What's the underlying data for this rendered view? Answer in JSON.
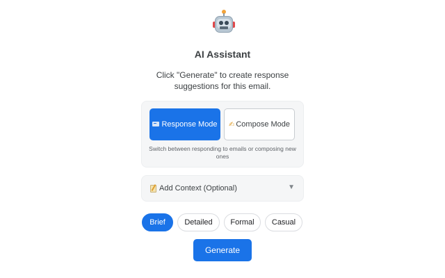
{
  "header": {
    "icon": "robot-icon",
    "title": "AI Assistant",
    "description": "Click \"Generate\" to create response suggestions for this email."
  },
  "modes": {
    "response": {
      "icon": "id-card-icon",
      "label": "Response Mode",
      "active": true
    },
    "compose": {
      "icon": "pencil-icon",
      "label": "Compose Mode",
      "active": false
    },
    "hint": "Switch between responding to emails or composing new ones"
  },
  "context": {
    "icon": "memo-icon",
    "label": "Add Context (Optional)",
    "chevron": "▼"
  },
  "tones": [
    {
      "label": "Brief",
      "active": true
    },
    {
      "label": "Detailed",
      "active": false
    },
    {
      "label": "Formal",
      "active": false
    },
    {
      "label": "Casual",
      "active": false
    }
  ],
  "actions": {
    "generate_label": "Generate"
  },
  "colors": {
    "accent": "#1a73e8",
    "card_bg": "#f5f6f7",
    "text": "#3c4043"
  }
}
